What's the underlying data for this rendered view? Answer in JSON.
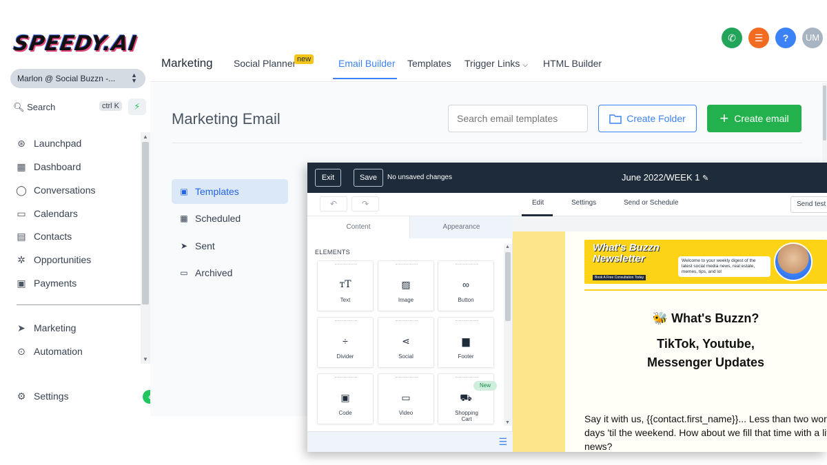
{
  "sidebar": {
    "logo": "SPEEDY.AI",
    "account": "Marlon @ Social Buzzn -...",
    "search_label": "Search",
    "search_shortcut": "ctrl K",
    "items": [
      {
        "label": "Launchpad",
        "icon": "rocket-icon"
      },
      {
        "label": "Dashboard",
        "icon": "grid-icon"
      },
      {
        "label": "Conversations",
        "icon": "chat-icon"
      },
      {
        "label": "Calendars",
        "icon": "calendar-icon"
      },
      {
        "label": "Contacts",
        "icon": "contacts-icon"
      },
      {
        "label": "Opportunities",
        "icon": "network-icon"
      },
      {
        "label": "Payments",
        "icon": "invoice-icon"
      },
      {
        "label": "Marketing",
        "icon": "send-icon"
      },
      {
        "label": "Automation",
        "icon": "play-circle-icon"
      }
    ],
    "settings_label": "Settings"
  },
  "topbar": {
    "avatar_initials": "UM",
    "colors": {
      "phone": "#22a55a",
      "list": "#f26b21",
      "help": "#3b82f6",
      "avatar": "#a9b4c2"
    },
    "tabs": {
      "marketing": "Marketing",
      "social_planner": "Social Planner",
      "new_badge": "new",
      "email_builder": "Email Builder",
      "templates": "Templates",
      "trigger_links": "Trigger Links",
      "html_builder": "HTML Builder"
    }
  },
  "main": {
    "title": "Marketing Email",
    "search_placeholder": "Search email templates",
    "create_folder": "Create Folder",
    "create_email": "Create email",
    "side_items": [
      "Templates",
      "Scheduled",
      "Sent",
      "Archived"
    ]
  },
  "builder": {
    "exit": "Exit",
    "save": "Save",
    "status": "No unsaved changes",
    "campaign": "June 2022/WEEK 1",
    "tabs": {
      "edit": "Edit",
      "settings": "Settings",
      "send": "Send or Schedule"
    },
    "send_test": "Send test",
    "panel_tabs": {
      "content": "Content",
      "appearance": "Appearance"
    },
    "elements_label": "ELEMENTS",
    "elements": [
      {
        "label": "Text",
        "icon": "text-icon"
      },
      {
        "label": "Image",
        "icon": "image-icon"
      },
      {
        "label": "Button",
        "icon": "link-icon"
      },
      {
        "label": "Divider",
        "icon": "divider-icon"
      },
      {
        "label": "Social",
        "icon": "share-icon"
      },
      {
        "label": "Footer",
        "icon": "footer-icon"
      },
      {
        "label": "Code",
        "icon": "terminal-icon"
      },
      {
        "label": "Video",
        "icon": "video-icon"
      },
      {
        "label": "Shopping Cart",
        "icon": "cart-icon"
      }
    ],
    "new_pill": "New",
    "email": {
      "banner_title_1": "What's Buzzn",
      "banner_title_2": "Newsletter",
      "banner_blurb": "Welcome to your weekly digest of the latest social media news, real estate, memes, tips, and lol",
      "banner_cta": "Book A Free Consultation Today",
      "heading": "🐝 What's Buzzn?",
      "sub_1": "TikTok, Youtube,",
      "sub_2": "Messenger Updates",
      "body": "Say it with us, {{contact.first_name}}... Less than two work days 'til the weekend. How about we fill that time with a little news?"
    }
  }
}
